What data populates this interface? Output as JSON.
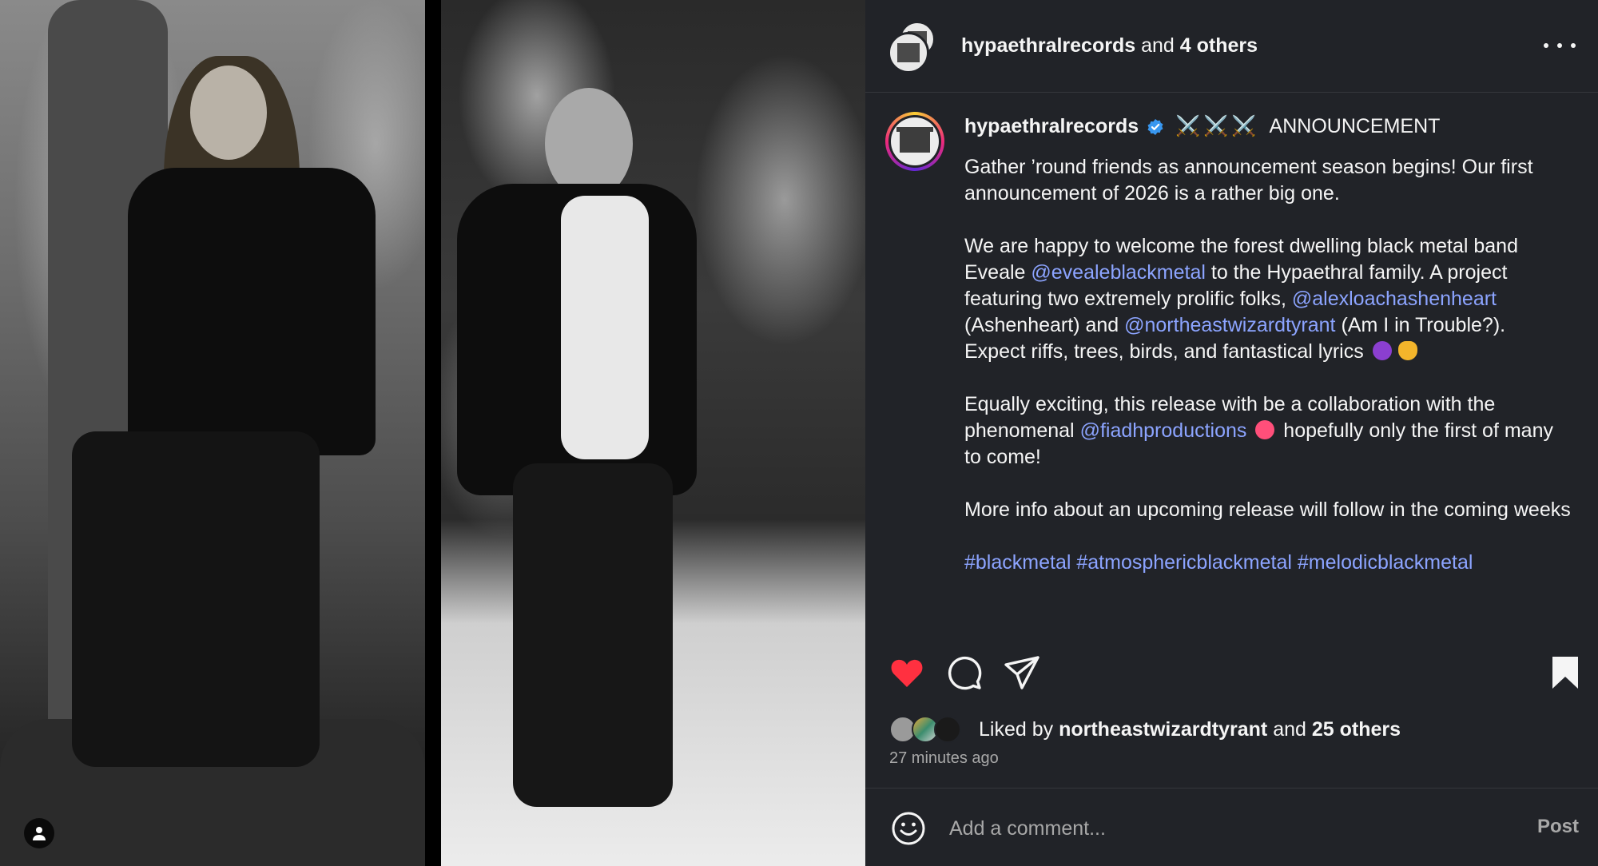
{
  "header": {
    "username": "hypaethralrecords",
    "and_text": "and",
    "others": "4 others",
    "more_icon": "more-horizontal-icon"
  },
  "caption": {
    "username": "hypaethralrecords",
    "verified_icon": "verified-badge-icon",
    "swords": "⚔️⚔️⚔️",
    "title": "ANNOUNCEMENT",
    "p1": "Gather ’round friends as announcement season begins! Our first announcement of 2026 is a rather big one.",
    "p2": {
      "t1": "We are happy to welcome the forest dwelling black metal band Eveale ",
      "m1": "@evealeblackmetal",
      "t2": " to the Hypaethral family. A project featuring two extremely prolific folks, ",
      "m2": "@alexloachashenheart",
      "t3": " (Ashenheart) and ",
      "m3": "@northeastwizardtyrant",
      "t4": " (Am I in Trouble?). Expect riffs, trees, birds, and fantastical lyrics"
    },
    "p3": {
      "t1": "Equally exciting, this release with be a collaboration with the phenomenal ",
      "m1": "@fiadhproductions",
      "t2": " hopefully only the first of many to come!"
    },
    "p4": "More info about an upcoming release will follow in the coming weeks",
    "hashtags": [
      "#blackmetal",
      "#atmosphericblackmetal",
      "#melodicblackmetal"
    ]
  },
  "actions": {
    "like_icon": "heart-filled-icon",
    "comment_icon": "comment-icon",
    "share_icon": "share-icon",
    "save_icon": "bookmark-filled-icon",
    "like_color": "#ff3040"
  },
  "likes": {
    "prefix": "Liked by",
    "user": "northeastwizardtyrant",
    "and_text": "and",
    "others": "25 others"
  },
  "timestamp": "27 minutes ago",
  "comment": {
    "placeholder": "Add a comment...",
    "post_label": "Post",
    "emoji_icon": "smiley-icon"
  },
  "media": {
    "user_tag_icon": "person-icon"
  },
  "colors": {
    "panel_bg": "#212328",
    "link": "#8ca4ff",
    "muted": "#a8a8a8"
  }
}
